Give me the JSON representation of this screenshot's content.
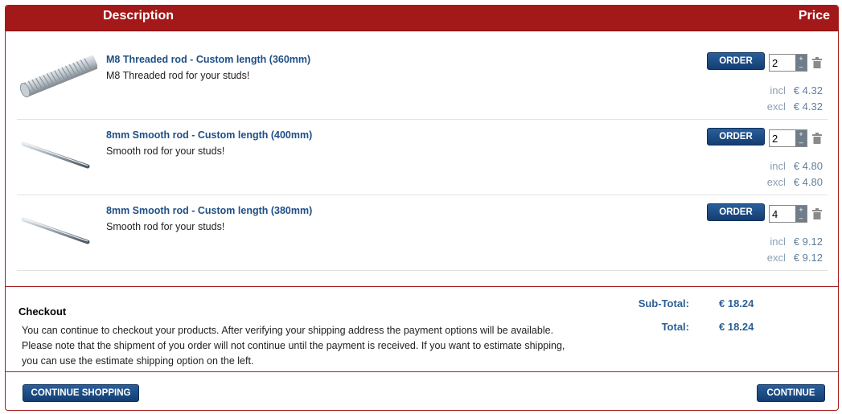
{
  "header": {
    "description": "Description",
    "price": "Price"
  },
  "items": [
    {
      "title": "M8 Threaded rod - Custom length (360mm)",
      "subtitle": "M8 Threaded rod for your studs!",
      "order_label": "ORDER",
      "quantity": "2",
      "incl_label": "incl",
      "incl_price": "€ 4.32",
      "excl_label": "excl",
      "excl_price": "€ 4.32",
      "image": "threaded-rod"
    },
    {
      "title": "8mm Smooth rod - Custom length (400mm)",
      "subtitle": "Smooth rod for your studs!",
      "order_label": "ORDER",
      "quantity": "2",
      "incl_label": "incl",
      "incl_price": "€ 4.80",
      "excl_label": "excl",
      "excl_price": "€ 4.80",
      "image": "smooth-rod"
    },
    {
      "title": "8mm Smooth rod - Custom length (380mm)",
      "subtitle": "Smooth rod for your studs!",
      "order_label": "ORDER",
      "quantity": "4",
      "incl_label": "incl",
      "incl_price": "€ 9.12",
      "excl_label": "excl",
      "excl_price": "€ 9.12",
      "image": "smooth-rod"
    }
  ],
  "checkout": {
    "title": "Checkout",
    "text": "You can continue to checkout your products. After verifying your shipping address the payment options will be available. Please note that the shipment of you order will not continue until the payment is received. If you want to estimate shipping, you can use the estimate shipping option on the left."
  },
  "totals": {
    "subtotal_label": "Sub-Total:",
    "subtotal_value": "€ 18.24",
    "total_label": "Total:",
    "total_value": "€ 18.24"
  },
  "buttons": {
    "continue_shopping": "CONTINUE SHOPPING",
    "continue": "CONTINUE"
  },
  "colors": {
    "brand_red": "#a31818",
    "link_blue": "#1f4f87",
    "button_blue": "#123d72"
  }
}
